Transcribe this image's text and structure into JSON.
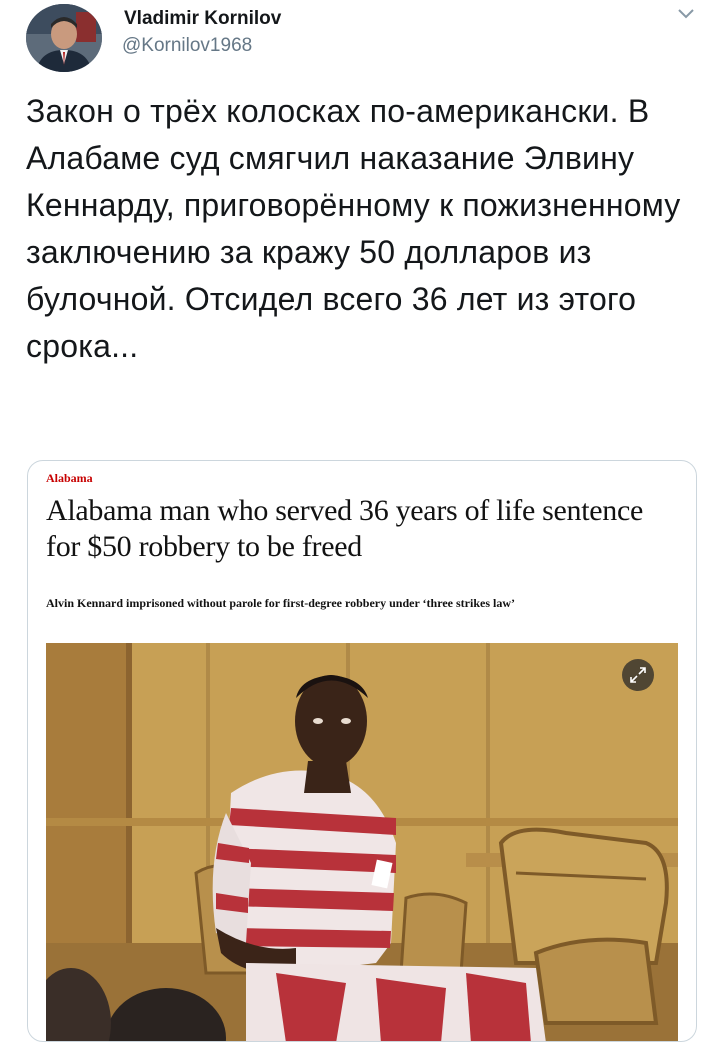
{
  "tweet": {
    "author_name": "Vladimir Kornilov",
    "author_handle": "@Kornilov1968",
    "text": "Закон о трёх колосках по-американски. В Алабаме суд смягчил наказание Элвину Кеннарду, приговорённому к пожизненному заключению за кражу 50 долларов из булочной. Отсидел всего 36 лет из этого срока..."
  },
  "card": {
    "section": "Alabama",
    "headline": "Alabama man who served 36 years of life sentence for $50 robbery to be freed",
    "standfirst": "Alvin Kennard imprisoned without parole for first-degree robbery under ‘three strikes law’",
    "accent_color": "#c70000",
    "photo_icon": "expand-icon"
  },
  "icons": {
    "menu": "chevron-down-icon"
  }
}
